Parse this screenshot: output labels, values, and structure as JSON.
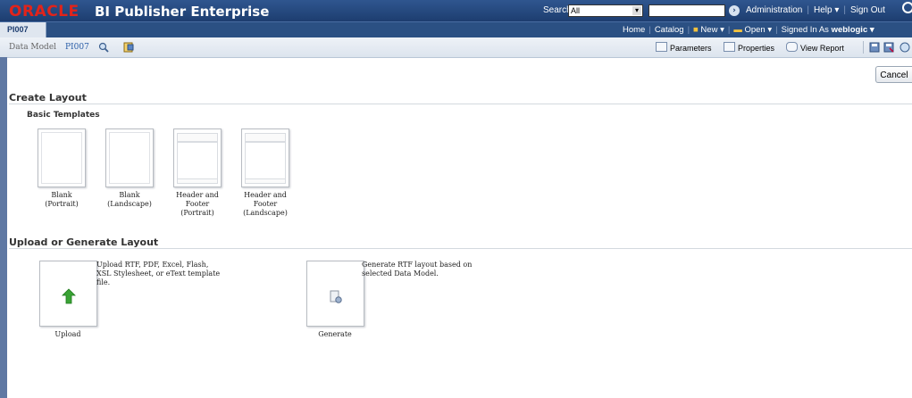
{
  "header": {
    "logo": "ORACLE",
    "product": "BI Publisher Enterprise",
    "search_label": "Search",
    "search_scope": "All",
    "links": [
      "Administration",
      "Help ▾",
      "Sign Out"
    ]
  },
  "tabs": {
    "active": "PI007"
  },
  "nav": {
    "home": "Home",
    "catalog": "Catalog",
    "new": "New ▾",
    "open": "Open ▾",
    "signed_in_label": "Signed In As",
    "user": "weblogic ▾"
  },
  "toolbar": {
    "data_model_label": "Data Model",
    "data_model_name": "PI007",
    "parameters": "Parameters",
    "properties": "Properties",
    "view_report": "View Report"
  },
  "cancel_label": "Cancel",
  "create_layout": {
    "title": "Create Layout",
    "basic_templates": "Basic Templates",
    "templates": [
      {
        "line1": "Blank",
        "line2": "(Portrait)",
        "line3": "",
        "line4": ""
      },
      {
        "line1": "Blank",
        "line2": "(Landscape)",
        "line3": "",
        "line4": ""
      },
      {
        "line1": "Header and",
        "line2": "Footer",
        "line3": "(Portrait)",
        "line4": ""
      },
      {
        "line1": "Header and",
        "line2": "Footer",
        "line3": "(Landscape)",
        "line4": ""
      }
    ]
  },
  "upload_generate": {
    "title": "Upload or Generate Layout",
    "upload_desc": [
      "Upload RTF, PDF, Excel, Flash,",
      "XSL Stylesheet, or eText template",
      "file."
    ],
    "upload_label": "Upload",
    "generate_desc": [
      "Generate RTF layout based on",
      "selected Data Model."
    ],
    "generate_label": "Generate"
  },
  "colors": {
    "brand_bar": "#1d3d6f",
    "oracle_red": "#e2231a",
    "upload_arrow": "#3aa335"
  }
}
